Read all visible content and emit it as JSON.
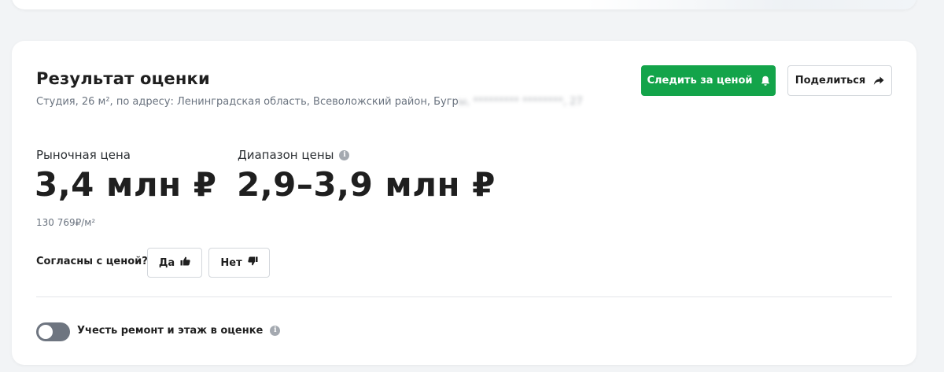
{
  "header": {
    "title": "Результат оценки",
    "address_visible": "Студия, 26 м², по адресу: Ленинградская область, Всеволожский район, Бугр",
    "address_hidden": "ы, ********* ********, 27"
  },
  "actions": {
    "follow_label": "Следить за ценой",
    "share_label": "Поделиться"
  },
  "market_price": {
    "label": "Рыночная цена",
    "value": "3,4 млн ₽",
    "per_sqm": "130 769₽/м²"
  },
  "price_range": {
    "label": "Диапазон цены",
    "value": "2,9–3,9 млн ₽"
  },
  "feedback": {
    "question": "Согласны с ценой?",
    "yes_label": "Да",
    "no_label": "Нет"
  },
  "settings": {
    "toggle_label": "Учесть ремонт и этаж в оценке",
    "toggle_on": false
  },
  "colors": {
    "accent": "#13a44a",
    "toggle_off": "#6e7580",
    "muted_text": "#6b7480"
  }
}
